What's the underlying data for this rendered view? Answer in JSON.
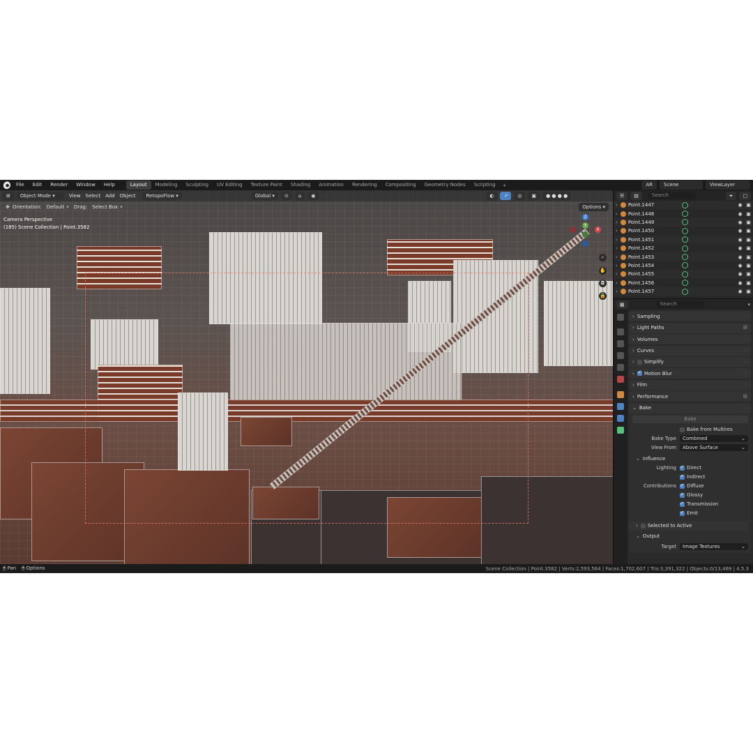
{
  "topbar": {
    "menus": [
      "File",
      "Edit",
      "Render",
      "Window",
      "Help"
    ],
    "workspaces": [
      "Layout",
      "Modeling",
      "Sculpting",
      "UV Editing",
      "Texture Paint",
      "Shading",
      "Animation",
      "Rendering",
      "Compositing",
      "Geometry Nodes",
      "Scripting"
    ],
    "active_workspace": "Layout",
    "plus": "+",
    "engine_badge": "AR",
    "scene": "Scene",
    "view_layer": "ViewLayer"
  },
  "viewport": {
    "mode": "Object Mode",
    "menus": [
      "View",
      "Select",
      "Add",
      "Object"
    ],
    "addon": "RetopoFlow",
    "transform_orientation": "Global",
    "orientation_label": "Orientation:",
    "orientation_value": "Default",
    "drag_label": "Drag:",
    "drag_value": "Select Box",
    "options": "Options",
    "camera_label": "Camera Perspective",
    "collection_label": "(185) Scene Collection | Point.3582",
    "gizmo": {
      "x": "X",
      "y": "Y",
      "z": "Z"
    }
  },
  "outliner": {
    "search_placeholder": "Search",
    "items": [
      "Point.1447",
      "Point.1448",
      "Point.1449",
      "Point.1450",
      "Point.1451",
      "Point.1452",
      "Point.1453",
      "Point.1454",
      "Point.1455",
      "Point.1456",
      "Point.1457"
    ]
  },
  "properties": {
    "search_placeholder": "Search",
    "panels": {
      "sampling": "Sampling",
      "light_paths": "Light Paths",
      "volumes": "Volumes",
      "curves": "Curves",
      "simplify": "Simplify",
      "motion_blur": "Motion Blur",
      "film": "Film",
      "performance": "Performance",
      "bake": "Bake"
    },
    "simplify_checked": false,
    "motion_blur_checked": true,
    "bake_button": "Bake",
    "bake_from_multires": "Bake from Multires",
    "bake_type_label": "Bake Type",
    "bake_type_value": "Combined",
    "view_from_label": "View From",
    "view_from_value": "Above Surface",
    "influence": "Influence",
    "lighting_label": "Lighting",
    "direct": "Direct",
    "indirect": "Indirect",
    "contributions_label": "Contributions",
    "diffuse": "Diffuse",
    "glossy": "Glossy",
    "transmission": "Transmission",
    "emit": "Emit",
    "selected_to_active": "Selected to Active",
    "output": "Output",
    "target_label": "Target",
    "target_value": "Image Textures"
  },
  "statusbar": {
    "pan": "Pan",
    "options": "Options",
    "stats": "Scene Collection | Point.3582 | Verts:2,593,564 | Faces:1,702,607 | Tris:3,391,322 | Objects:0/13,469 | 4.5.3"
  },
  "colors": {
    "accent": "#4f82c3",
    "x_axis": "#d9414b",
    "y_axis": "#6aa84f",
    "z_axis": "#3f7fd8",
    "object_icon": "#d0893f"
  }
}
